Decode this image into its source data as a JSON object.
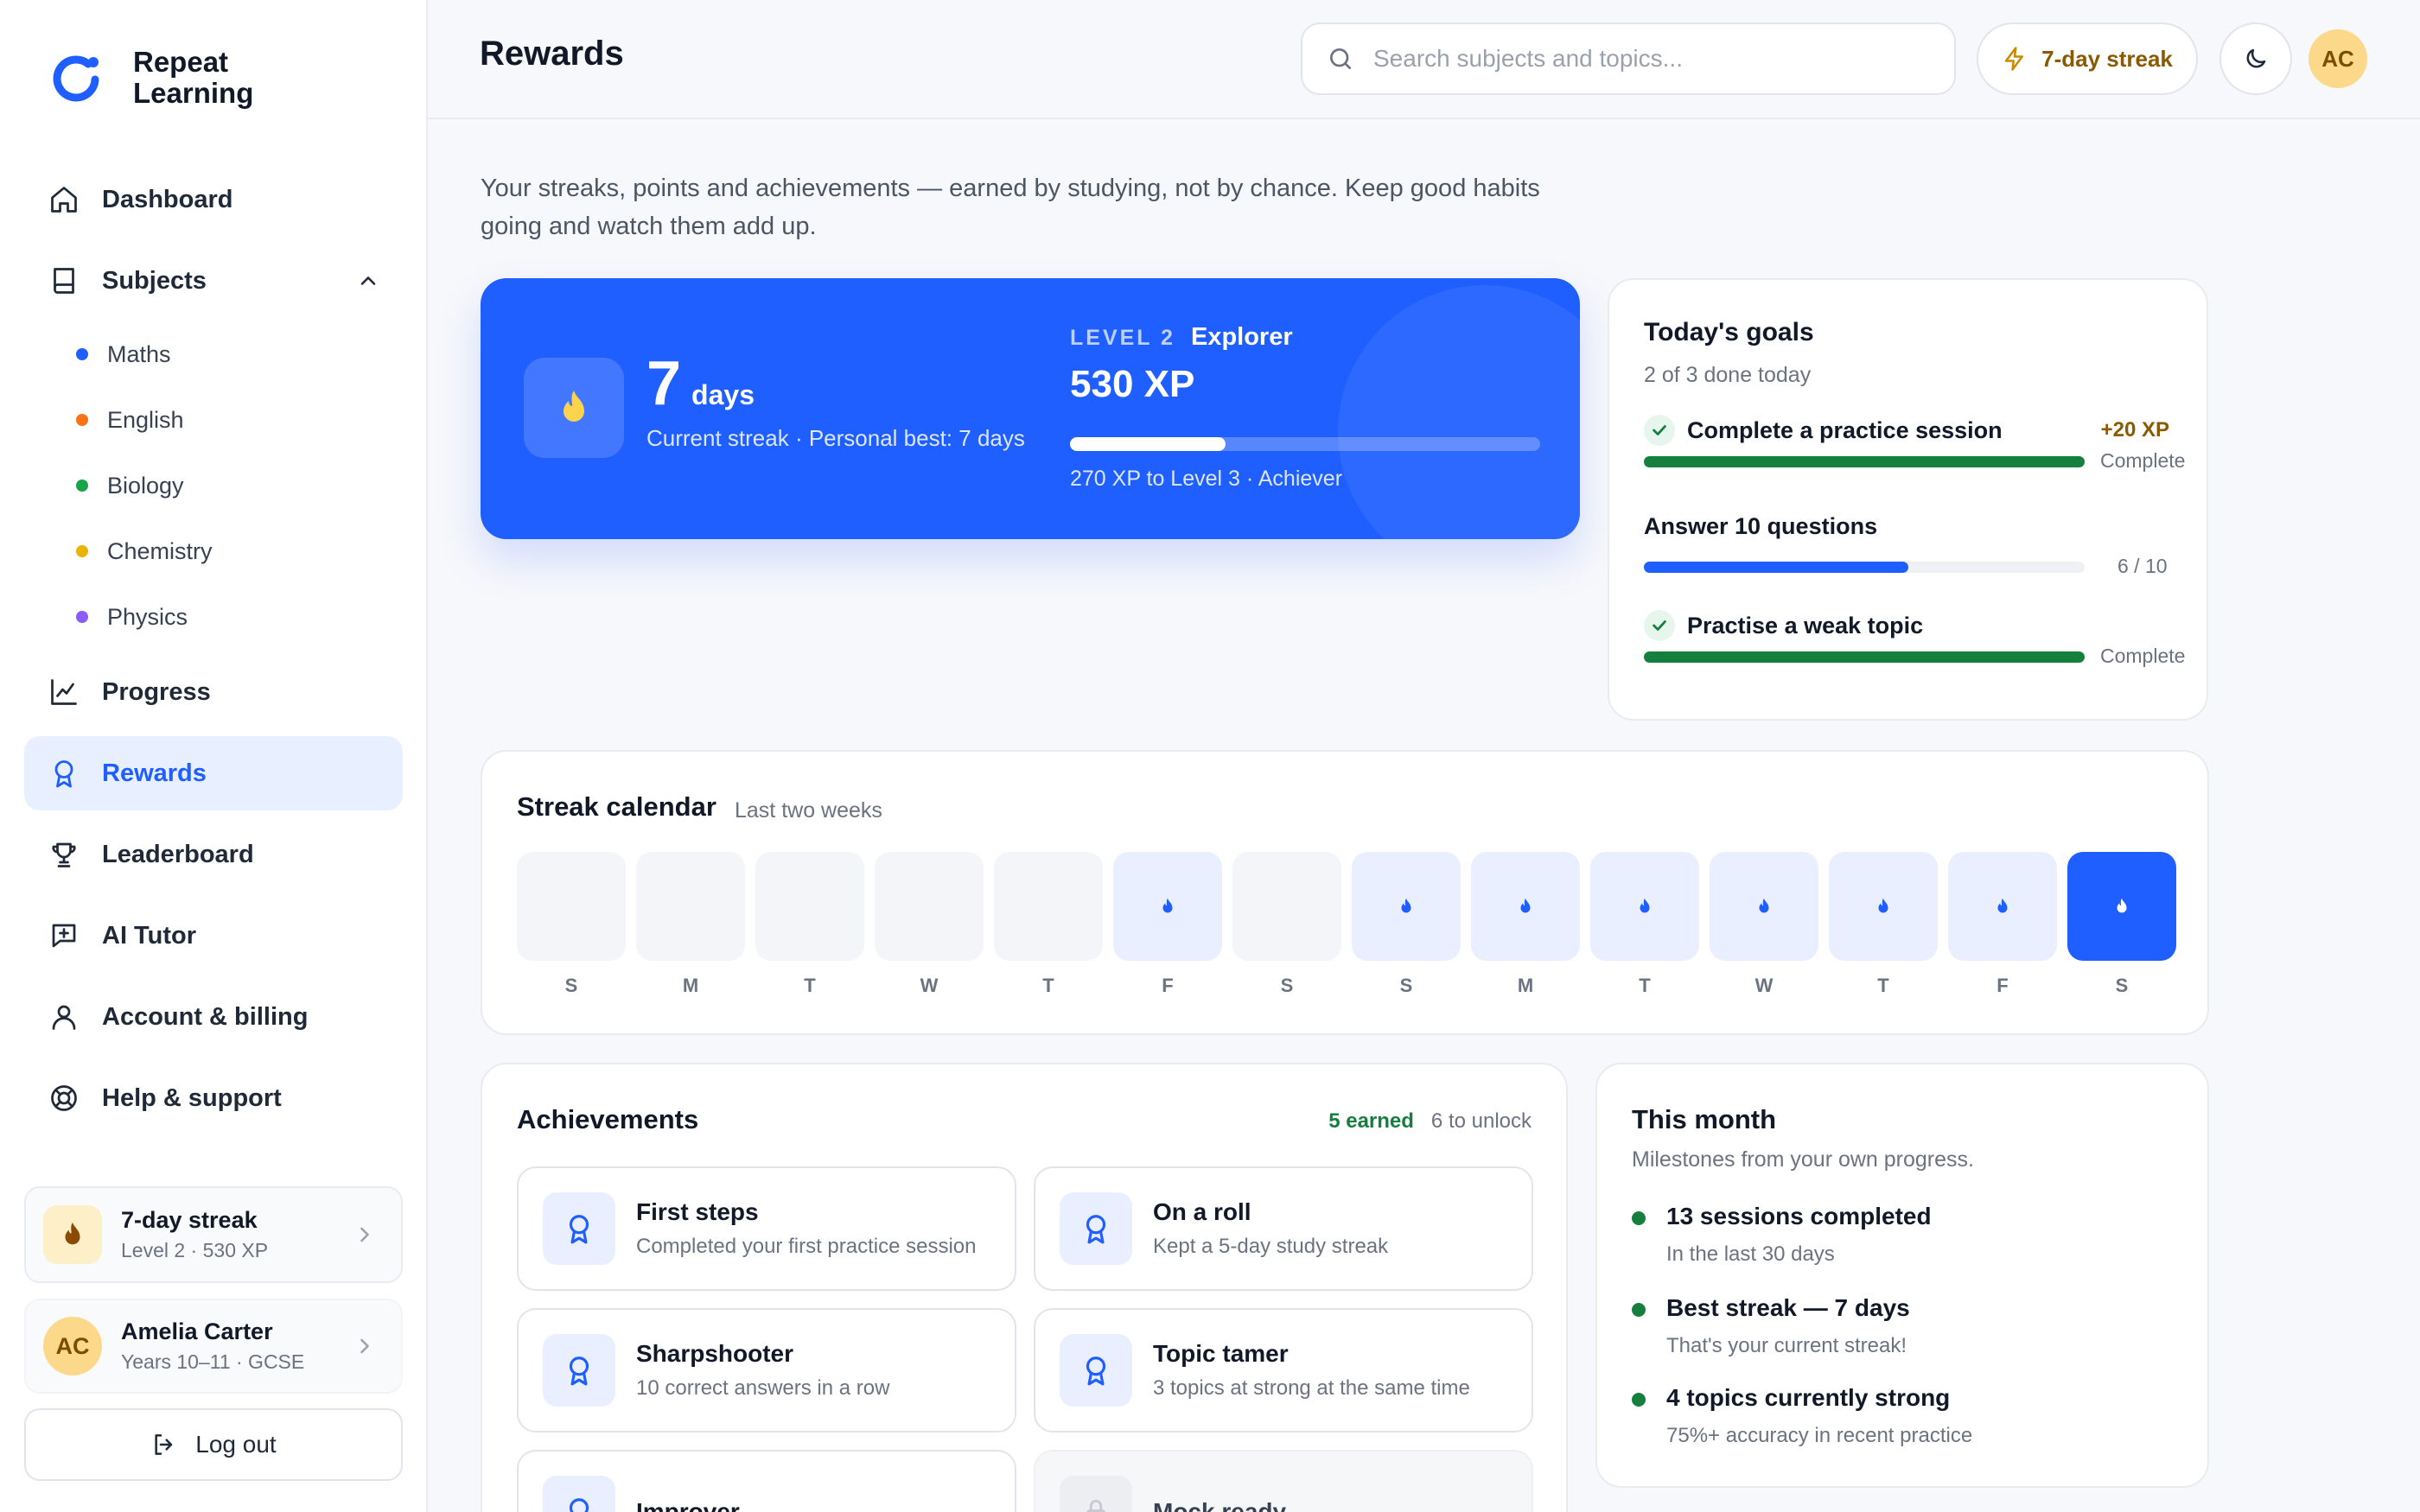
{
  "brand": {
    "name": "Repeat Learning"
  },
  "sidebar": {
    "nav": [
      {
        "label": "Dashboard",
        "icon": "home-icon"
      },
      {
        "label": "Subjects",
        "icon": "book-icon",
        "expanded": true
      },
      {
        "label": "Progress",
        "icon": "chart-icon"
      },
      {
        "label": "Rewards",
        "icon": "award-icon",
        "active": true
      },
      {
        "label": "Leaderboard",
        "icon": "trophy-icon"
      },
      {
        "label": "AI Tutor",
        "icon": "chat-sparkle-icon"
      },
      {
        "label": "Account & billing",
        "icon": "user-icon"
      },
      {
        "label": "Help & support",
        "icon": "lifebuoy-icon"
      }
    ],
    "subjects": [
      {
        "label": "Maths",
        "color": "#1f5eff"
      },
      {
        "label": "English",
        "color": "#f97316"
      },
      {
        "label": "Biology",
        "color": "#16a34a"
      },
      {
        "label": "Chemistry",
        "color": "#eab308"
      },
      {
        "label": "Physics",
        "color": "#8b5cf6"
      }
    ],
    "streak_card": {
      "title": "7-day streak",
      "subtitle": "Level 2 · 530 XP"
    },
    "user_card": {
      "initials": "AC",
      "name": "Amelia Carter",
      "subtitle": "Years 10–11 · GCSE"
    },
    "logout_label": "Log out"
  },
  "header": {
    "title": "Rewards",
    "search_placeholder": "Search subjects and topics...",
    "streak_label": "7-day streak",
    "avatar_initials": "AC"
  },
  "intro": "Your streaks, points and achievements — earned by studying, not by chance. Keep good habits going and watch them add up.",
  "hero": {
    "days_value": "7",
    "days_unit": "days",
    "streak_sub": "Current streak · Personal best: 7 days",
    "level_label": "LEVEL 2",
    "level_name": "Explorer",
    "xp": "530 XP",
    "level_progress": 0.33,
    "next_level": "270 XP to Level 3 · Achiever"
  },
  "goals": {
    "title": "Today's goals",
    "subtitle": "2 of 3 done today",
    "items": [
      {
        "label": "Complete a practice session",
        "xp": "+20 XP",
        "progress": 1.0,
        "state": "Complete",
        "done": true,
        "color": "#15803d"
      },
      {
        "label": "Answer 10 questions",
        "xp": "",
        "progress": 0.6,
        "state": "6 / 10",
        "done": false,
        "color": "#1f5eff"
      },
      {
        "label": "Practise a weak topic",
        "xp": "",
        "progress": 1.0,
        "state": "Complete",
        "done": true,
        "color": "#15803d"
      }
    ]
  },
  "calendar": {
    "title": "Streak calendar",
    "hint": "Last two weeks",
    "days": [
      {
        "label": "S",
        "status": "none"
      },
      {
        "label": "M",
        "status": "none"
      },
      {
        "label": "T",
        "status": "none"
      },
      {
        "label": "W",
        "status": "none"
      },
      {
        "label": "T",
        "status": "none"
      },
      {
        "label": "F",
        "status": "done"
      },
      {
        "label": "S",
        "status": "none"
      },
      {
        "label": "S",
        "status": "done"
      },
      {
        "label": "M",
        "status": "done"
      },
      {
        "label": "T",
        "status": "done"
      },
      {
        "label": "W",
        "status": "done"
      },
      {
        "label": "T",
        "status": "done"
      },
      {
        "label": "F",
        "status": "done"
      },
      {
        "label": "S",
        "status": "today"
      }
    ]
  },
  "achievements": {
    "title": "Achievements",
    "earned_label": "5 earned",
    "unlock_label": "6 to unlock",
    "items": [
      {
        "title": "First steps",
        "desc": "Completed your first practice session",
        "locked": false
      },
      {
        "title": "On a roll",
        "desc": "Kept a 5-day study streak",
        "locked": false
      },
      {
        "title": "Sharpshooter",
        "desc": "10 correct answers in a row",
        "locked": false
      },
      {
        "title": "Topic tamer",
        "desc": "3 topics at strong at the same time",
        "locked": false
      },
      {
        "title": "Improver",
        "desc": "",
        "locked": false
      },
      {
        "title": "Mock ready",
        "desc": "",
        "locked": true
      }
    ]
  },
  "month": {
    "title": "This month",
    "subtitle": "Milestones from your own progress.",
    "items": [
      {
        "title": "13 sessions completed",
        "desc": "In the last 30 days"
      },
      {
        "title": "Best streak — 7 days",
        "desc": "That's your current streak!"
      },
      {
        "title": "4 topics currently strong",
        "desc": "75%+ accuracy in recent practice"
      }
    ]
  }
}
